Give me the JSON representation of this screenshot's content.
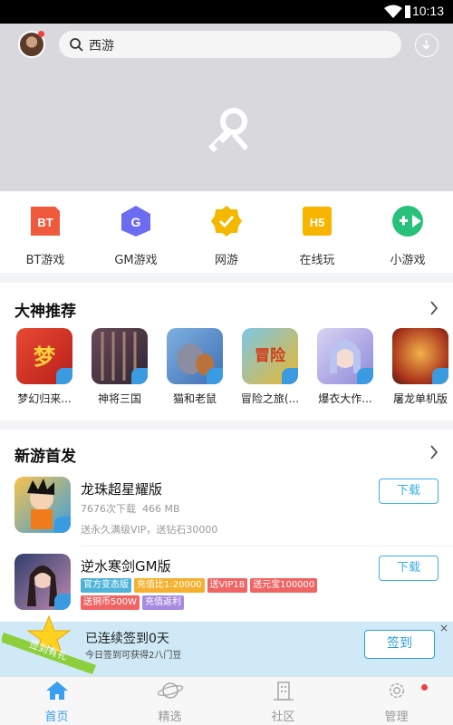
{
  "status_bar": {
    "time": "10:13"
  },
  "header": {
    "search_text": "西游",
    "icons": [
      "avatar",
      "search-icon",
      "download-icon"
    ]
  },
  "banner": {
    "icon": "key-wrench-icon",
    "dot_count": 5,
    "active_dot": 1
  },
  "categories": [
    {
      "label": "BT游戏",
      "icon_text": "BT",
      "color": "#f05a3c"
    },
    {
      "label": "GM游戏",
      "icon_text": "G",
      "color": "#6b6cf0"
    },
    {
      "label": "网游",
      "icon_text": "✓",
      "color": "#f5b800"
    },
    {
      "label": "在线玩",
      "icon_text": "H5",
      "color": "#f7b500"
    },
    {
      "label": "小游戏",
      "icon_text": "",
      "color": "#27c17b"
    }
  ],
  "section_recommend": {
    "title": "大神推荐",
    "games": [
      {
        "label": "梦幻归来...",
        "color": "#d6392b"
      },
      {
        "label": "神将三国",
        "color": "#4a3a46"
      },
      {
        "label": "猫和老鼠",
        "color": "#5c8fc8"
      },
      {
        "label": "冒险之旅(...",
        "color": "#e6b02b"
      },
      {
        "label": "爆衣大作...",
        "color": "#b7b3e8"
      },
      {
        "label": "屠龙单机版",
        "color": "#b8431c"
      }
    ]
  },
  "section_new": {
    "title": "新游首发",
    "items": [
      {
        "name": "龙珠超星耀版",
        "downloads": "7676次下载",
        "size": "466 MB",
        "desc": "送永久满级VIP，送钻石30000",
        "button": "下载"
      },
      {
        "name": "逆水寒剑GM版",
        "button": "下载",
        "tags": [
          {
            "text": "官方变态版",
            "color": "#4fb3d9"
          },
          {
            "text": "充值比1:20000",
            "color": "#f5b12e"
          },
          {
            "text": "送VIP18",
            "color": "#f06464"
          },
          {
            "text": "送元宝100000",
            "color": "#f06464"
          },
          {
            "text": "送铜币500W",
            "color": "#f06464"
          },
          {
            "text": "充值返利",
            "color": "#a78be0"
          }
        ]
      }
    ]
  },
  "signin": {
    "ribbon": "签到有礼",
    "main": "已连续签到0天",
    "sub": "今日签到可获得2八门豆",
    "button": "签到",
    "close": "×"
  },
  "nav": {
    "items": [
      {
        "label": "首页",
        "icon": "home-icon",
        "active": true
      },
      {
        "label": "精选",
        "icon": "planet-icon",
        "active": false
      },
      {
        "label": "社区",
        "icon": "building-icon",
        "active": false
      },
      {
        "label": "管理",
        "icon": "gear-icon",
        "active": false
      }
    ]
  },
  "colors": {
    "accent": "#3a9ff0",
    "button_border": "#3aaee0",
    "badge_red": "#f04141"
  }
}
